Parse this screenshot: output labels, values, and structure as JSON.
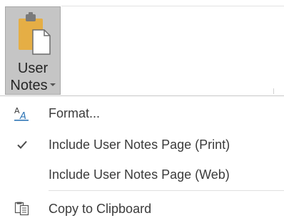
{
  "ribbon": {
    "user_notes_button": {
      "line1": "User",
      "line2": "Notes",
      "icon": "clipboard-page-icon"
    }
  },
  "menu": {
    "items": [
      {
        "label": "Format...",
        "icon": "text-format-icon"
      },
      {
        "label": "Include User Notes Page (Print)",
        "icon": "checkmark-icon",
        "checked": true
      },
      {
        "label": "Include User Notes Page (Web)",
        "checked": false
      },
      {
        "label": "Copy to Clipboard",
        "icon": "copy-clipboard-icon"
      }
    ]
  },
  "colors": {
    "button_pressed_bg": "#c5c5c5",
    "clipboard_gold": "#e5ae45",
    "menu_text": "#3b3b3b",
    "format_icon_blue": "#2e75b6"
  }
}
